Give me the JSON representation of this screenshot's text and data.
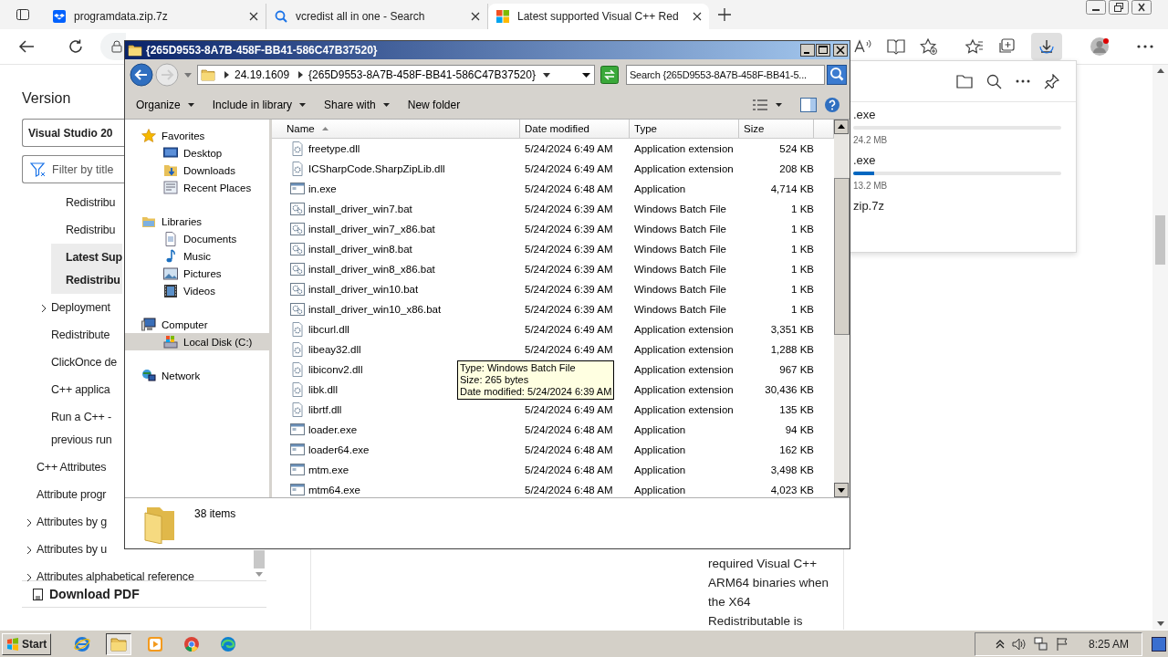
{
  "browser": {
    "tabs": [
      {
        "title": "programdata.zip.7z",
        "kind": "box",
        "selected": false
      },
      {
        "title": "vcredist all in one - Search",
        "kind": "search",
        "selected": false
      },
      {
        "title": "Latest supported Visual C++ Red",
        "kind": "squares",
        "selected": true
      }
    ],
    "downloads_open": true,
    "nav": {
      "heading": "Version",
      "version_select": "Visual Studio 20",
      "filter_placeholder": "Filter by title",
      "toc": [
        {
          "children": [
            {
              "children": [
                {
                  "lines": [
                    "Redistribu"
                  ],
                  "selected": false
                },
                {
                  "lines": [
                    "Redistribu"
                  ],
                  "selected": false
                },
                {
                  "lines": [
                    "Latest Sup",
                    "Redistribu"
                  ],
                  "selected": true
                }
              ]
            },
            {
              "lines": [
                "Deployment"
              ],
              "expanded": false,
              "selected": false
            },
            {
              "lines": [
                "Redistribute"
              ],
              "selected": false
            },
            {
              "lines": [
                "ClickOnce de"
              ],
              "selected": false
            },
            {
              "lines": [
                "C++ applica"
              ],
              "selected": false
            },
            {
              "lines": [
                "Run a C++ -",
                "previous run"
              ],
              "selected": false
            }
          ]
        },
        {
          "lines": [
            "C++ Attributes"
          ],
          "selected": false
        },
        {
          "lines": [
            "Attribute progr"
          ],
          "selected": false
        },
        {
          "lines": [
            "Attributes by g"
          ],
          "expanded": false,
          "selected": false
        },
        {
          "lines": [
            "Attributes by u"
          ],
          "expanded": false,
          "selected": false
        },
        {
          "lines": [
            "Attributes alphabetical reference"
          ],
          "expanded": false,
          "selected": false
        }
      ],
      "download_pdf": "Download PDF"
    },
    "article_lines": [
      "required Visual C++",
      "ARM64 binaries when",
      "the X64",
      "Redistributable is"
    ],
    "downloads": [
      {
        "name": ".exe",
        "status": "24.2 MB",
        "level": 0
      },
      {
        "name": ".exe",
        "status": "13.2 MB",
        "level": 0.1
      },
      {
        "name": "zip.7z"
      }
    ]
  },
  "explorer": {
    "title": "{265D9553-8A7B-458F-BB41-586C47B37520}",
    "breadcrumb": [
      "24.19.1609",
      "{265D9553-8A7B-458F-BB41-586C47B37520}"
    ],
    "search_placeholder": "Search {265D9553-8A7B-458F-BB41-5...",
    "commands": [
      {
        "label": "Organize",
        "menu": true
      },
      {
        "label": "Include in library",
        "menu": true
      },
      {
        "label": "Share with",
        "menu": true
      },
      {
        "label": "New folder",
        "menu": false
      }
    ],
    "nav": [
      {
        "label": "Favorites",
        "kind": "star",
        "selected": false,
        "children": [
          {
            "label": "Desktop",
            "kind": "desktop",
            "selected": false
          },
          {
            "label": "Downloads",
            "kind": "downloads",
            "selected": false
          },
          {
            "label": "Recent Places",
            "kind": "recent",
            "selected": false
          }
        ]
      },
      {
        "label": "Libraries",
        "kind": "library",
        "selected": false,
        "children": [
          {
            "label": "Documents",
            "kind": "document",
            "selected": false
          },
          {
            "label": "Music",
            "kind": "music",
            "selected": false
          },
          {
            "label": "Pictures",
            "kind": "pictures",
            "selected": false
          },
          {
            "label": "Videos",
            "kind": "videos",
            "selected": false
          }
        ]
      },
      {
        "label": "Computer",
        "kind": "computer",
        "selected": false,
        "children": [
          {
            "label": "Local Disk (C:)",
            "kind": "disk",
            "selected": true
          }
        ]
      },
      {
        "label": "Network",
        "kind": "network",
        "selected": false
      }
    ],
    "columns": [
      {
        "label": "Name",
        "sorted": true
      },
      {
        "label": "Date modified",
        "sorted": false
      },
      {
        "label": "Type",
        "sorted": false
      },
      {
        "label": "Size",
        "sorted": false
      }
    ],
    "rows": [
      {
        "kind": "dll",
        "name": "freetype.dll",
        "date": "5/24/2024 6:49 AM",
        "type": "Application extension",
        "size": "524 KB"
      },
      {
        "kind": "dll",
        "name": "ICSharpCode.SharpZipLib.dll",
        "date": "5/24/2024 6:49 AM",
        "type": "Application extension",
        "size": "208 KB"
      },
      {
        "kind": "exe",
        "name": "in.exe",
        "date": "5/24/2024 6:48 AM",
        "type": "Application",
        "size": "4,714 KB"
      },
      {
        "kind": "bat",
        "name": "install_driver_win7.bat",
        "date": "5/24/2024 6:39 AM",
        "type": "Windows Batch File",
        "size": "1 KB"
      },
      {
        "kind": "bat",
        "name": "install_driver_win7_x86.bat",
        "date": "5/24/2024 6:39 AM",
        "type": "Windows Batch File",
        "size": "1 KB"
      },
      {
        "kind": "bat",
        "name": "install_driver_win8.bat",
        "date": "5/24/2024 6:39 AM",
        "type": "Windows Batch File",
        "size": "1 KB"
      },
      {
        "kind": "bat",
        "name": "install_driver_win8_x86.bat",
        "date": "5/24/2024 6:39 AM",
        "type": "Windows Batch File",
        "size": "1 KB"
      },
      {
        "kind": "bat",
        "name": "install_driver_win10.bat",
        "date": "5/24/2024 6:39 AM",
        "type": "Windows Batch File",
        "size": "1 KB"
      },
      {
        "kind": "bat",
        "name": "install_driver_win10_x86.bat",
        "date": "5/24/2024 6:39 AM",
        "type": "Windows Batch File",
        "size": "1 KB"
      },
      {
        "kind": "dll",
        "name": "libcurl.dll",
        "date": "5/24/2024 6:49 AM",
        "type": "Application extension",
        "size": "3,351 KB"
      },
      {
        "kind": "dll",
        "name": "libeay32.dll",
        "date": "5/24/2024 6:49 AM",
        "type": "Application extension",
        "size": "1,288 KB"
      },
      {
        "kind": "dll",
        "name": "libiconv2.dll",
        "type": "Application extension",
        "size": "967 KB"
      },
      {
        "kind": "dll",
        "name": "libk.dll",
        "type": "Application extension",
        "size": "30,436 KB"
      },
      {
        "kind": "dll",
        "name": "librtf.dll",
        "date": "5/24/2024 6:49 AM",
        "type": "Application extension",
        "size": "135 KB"
      },
      {
        "kind": "exe",
        "name": "loader.exe",
        "date": "5/24/2024 6:48 AM",
        "type": "Application",
        "size": "94 KB"
      },
      {
        "kind": "exe",
        "name": "loader64.exe",
        "date": "5/24/2024 6:48 AM",
        "type": "Application",
        "size": "162 KB"
      },
      {
        "kind": "exe",
        "name": "mtm.exe",
        "date": "5/24/2024 6:48 AM",
        "type": "Application",
        "size": "3,498 KB"
      },
      {
        "kind": "exe",
        "name": "mtm64.exe",
        "date": "5/24/2024 6:48 AM",
        "type": "Application",
        "size": "4,023 KB"
      }
    ],
    "tooltip": [
      "Type: Windows Batch File",
      "Size: 265 bytes",
      "Date modified: 5/24/2024 6:39 AM"
    ],
    "status": "38 items"
  },
  "taskbar": {
    "start": "Start",
    "apps": [
      {
        "kind": "ie",
        "selected": false
      },
      {
        "kind": "explorer",
        "selected": true
      },
      {
        "kind": "media",
        "selected": false
      },
      {
        "kind": "chrome",
        "selected": false
      },
      {
        "kind": "edge",
        "selected": false
      }
    ],
    "clock": "8:25 AM"
  }
}
